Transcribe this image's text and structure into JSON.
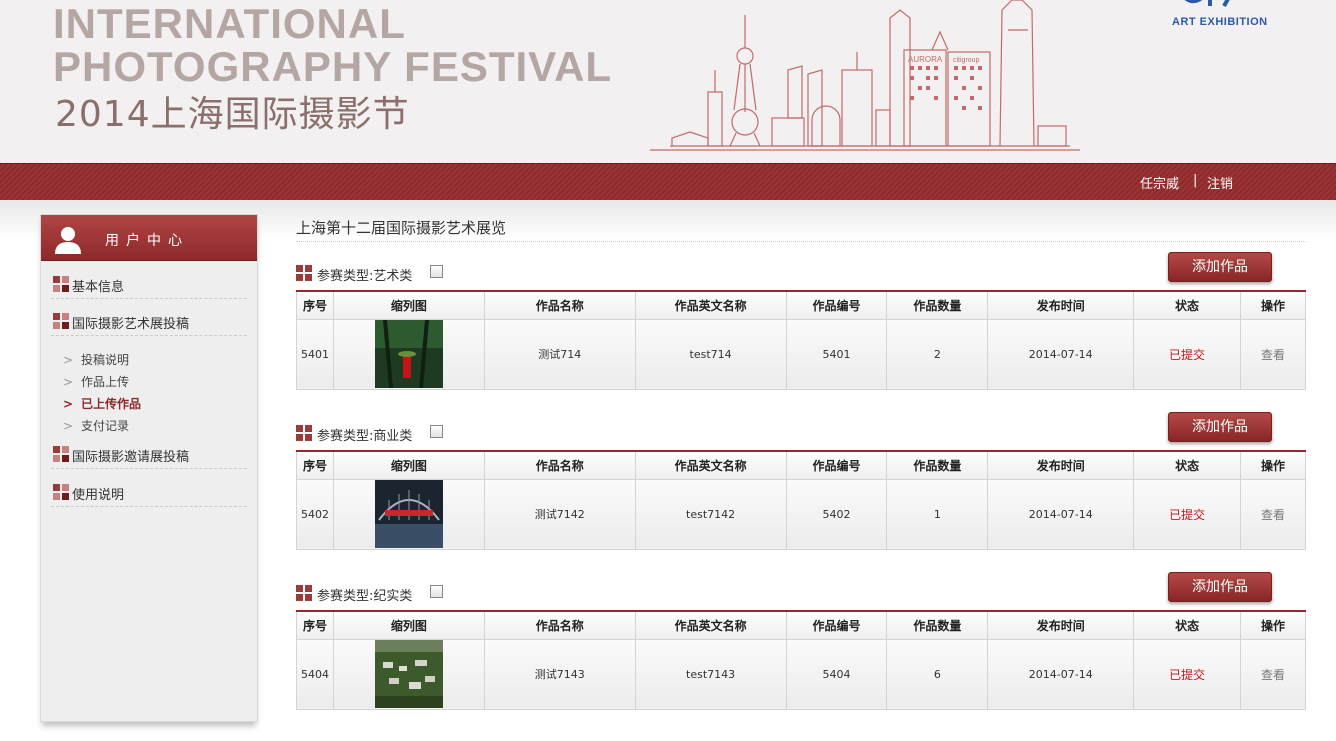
{
  "header": {
    "title_en_line1": "INTERNATIONAL",
    "title_en_line2": "PHOTOGRAPHY FESTIVAL",
    "title_cn": "2014上海国际摄影节",
    "art_exhibition": "ART EXHIBITION",
    "skyline_labels": [
      "AURORA",
      "citigroup"
    ]
  },
  "userbar": {
    "username": "任宗威",
    "separator": "|",
    "logout": "注销"
  },
  "sidebar": {
    "title": "用户中心",
    "items": [
      {
        "label": "基本信息"
      },
      {
        "label": "国际摄影艺术展投稿"
      },
      {
        "label": "国际摄影邀请展投稿"
      },
      {
        "label": "使用说明"
      }
    ],
    "subitems": [
      {
        "label": "投稿说明",
        "active": false
      },
      {
        "label": "作品上传",
        "active": false
      },
      {
        "label": "已上传作品",
        "active": true
      },
      {
        "label": "支付记录",
        "active": false
      }
    ]
  },
  "main": {
    "title": "上海第十二届国际摄影艺术展览",
    "add_button": "添加作品",
    "columns": [
      "序号",
      "缩列图",
      "作品名称",
      "作品英文名称",
      "作品编号",
      "作品数量",
      "发布时间",
      "状态",
      "操作"
    ],
    "sections": [
      {
        "category": "参赛类型:艺术类",
        "rows": [
          {
            "seq": "5401",
            "name": "测试714",
            "name_en": "test714",
            "number": "5401",
            "count": "2",
            "date": "2014-07-14",
            "status": "已提交",
            "action": "查看"
          }
        ]
      },
      {
        "category": "参赛类型:商业类",
        "rows": [
          {
            "seq": "5402",
            "name": "测试7142",
            "name_en": "test7142",
            "number": "5402",
            "count": "1",
            "date": "2014-07-14",
            "status": "已提交",
            "action": "查看"
          }
        ]
      },
      {
        "category": "参赛类型:纪实类",
        "rows": [
          {
            "seq": "5404",
            "name": "测试7143",
            "name_en": "test7143",
            "number": "5404",
            "count": "6",
            "date": "2014-07-14",
            "status": "已提交",
            "action": "查看"
          }
        ]
      }
    ]
  },
  "colors": {
    "brand_red": "#8e2a2a",
    "status_red": "#c01818",
    "link_blue": "#2a5aa8"
  }
}
